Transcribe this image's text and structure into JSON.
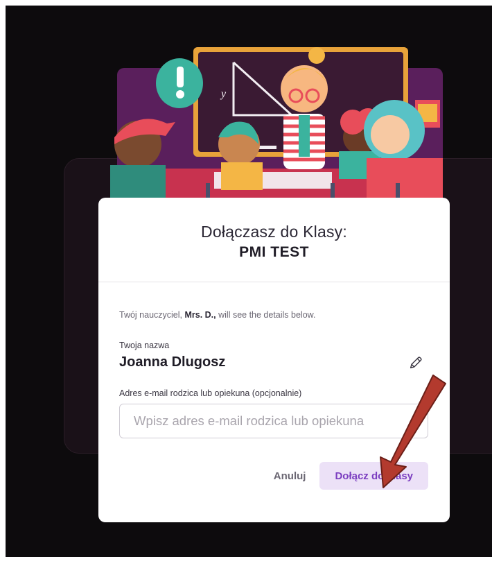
{
  "dialog": {
    "join_title": "Dołączasz do Klasy:",
    "class_name": "PMI TEST",
    "teacher_prefix": "Twój nauczyciel, ",
    "teacher_name": "Mrs. D.,",
    "teacher_suffix": " will see the details below.",
    "name_label": "Twoja nazwa",
    "name_value": "Joanna Dlugosz",
    "email_label": "Adres e-mail rodzica lub opiekuna (opcjonalnie)",
    "email_placeholder": "Wpisz adres e-mail rodzica lub opiekuna",
    "email_value": "",
    "cancel_label": "Anuluj",
    "join_label": "Dołącz do klasy"
  },
  "icons": {
    "edit": "pencil-icon",
    "annotation": "red-arrow"
  },
  "colors": {
    "join_button_bg": "#ece1f7",
    "join_button_text": "#7b3ec0",
    "annotation_arrow": "#b33a2e",
    "backdrop": "#0d0b0d"
  }
}
